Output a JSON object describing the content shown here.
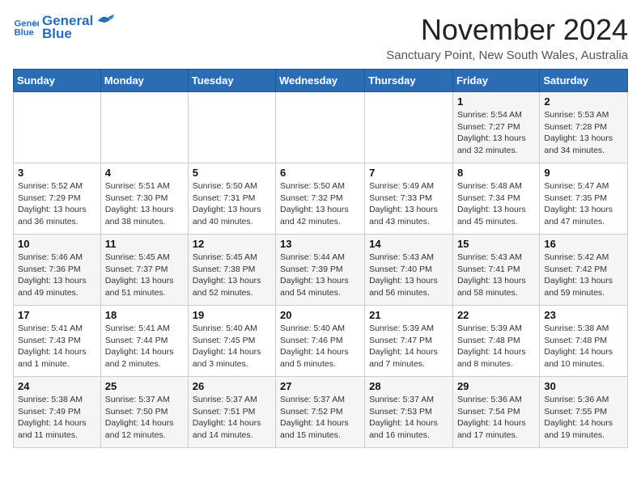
{
  "logo": {
    "line1": "General",
    "line2": "Blue"
  },
  "title": "November 2024",
  "location": "Sanctuary Point, New South Wales, Australia",
  "days_of_week": [
    "Sunday",
    "Monday",
    "Tuesday",
    "Wednesday",
    "Thursday",
    "Friday",
    "Saturday"
  ],
  "weeks": [
    [
      {
        "day": "",
        "info": ""
      },
      {
        "day": "",
        "info": ""
      },
      {
        "day": "",
        "info": ""
      },
      {
        "day": "",
        "info": ""
      },
      {
        "day": "",
        "info": ""
      },
      {
        "day": "1",
        "info": "Sunrise: 5:54 AM\nSunset: 7:27 PM\nDaylight: 13 hours and 32 minutes."
      },
      {
        "day": "2",
        "info": "Sunrise: 5:53 AM\nSunset: 7:28 PM\nDaylight: 13 hours and 34 minutes."
      }
    ],
    [
      {
        "day": "3",
        "info": "Sunrise: 5:52 AM\nSunset: 7:29 PM\nDaylight: 13 hours and 36 minutes."
      },
      {
        "day": "4",
        "info": "Sunrise: 5:51 AM\nSunset: 7:30 PM\nDaylight: 13 hours and 38 minutes."
      },
      {
        "day": "5",
        "info": "Sunrise: 5:50 AM\nSunset: 7:31 PM\nDaylight: 13 hours and 40 minutes."
      },
      {
        "day": "6",
        "info": "Sunrise: 5:50 AM\nSunset: 7:32 PM\nDaylight: 13 hours and 42 minutes."
      },
      {
        "day": "7",
        "info": "Sunrise: 5:49 AM\nSunset: 7:33 PM\nDaylight: 13 hours and 43 minutes."
      },
      {
        "day": "8",
        "info": "Sunrise: 5:48 AM\nSunset: 7:34 PM\nDaylight: 13 hours and 45 minutes."
      },
      {
        "day": "9",
        "info": "Sunrise: 5:47 AM\nSunset: 7:35 PM\nDaylight: 13 hours and 47 minutes."
      }
    ],
    [
      {
        "day": "10",
        "info": "Sunrise: 5:46 AM\nSunset: 7:36 PM\nDaylight: 13 hours and 49 minutes."
      },
      {
        "day": "11",
        "info": "Sunrise: 5:45 AM\nSunset: 7:37 PM\nDaylight: 13 hours and 51 minutes."
      },
      {
        "day": "12",
        "info": "Sunrise: 5:45 AM\nSunset: 7:38 PM\nDaylight: 13 hours and 52 minutes."
      },
      {
        "day": "13",
        "info": "Sunrise: 5:44 AM\nSunset: 7:39 PM\nDaylight: 13 hours and 54 minutes."
      },
      {
        "day": "14",
        "info": "Sunrise: 5:43 AM\nSunset: 7:40 PM\nDaylight: 13 hours and 56 minutes."
      },
      {
        "day": "15",
        "info": "Sunrise: 5:43 AM\nSunset: 7:41 PM\nDaylight: 13 hours and 58 minutes."
      },
      {
        "day": "16",
        "info": "Sunrise: 5:42 AM\nSunset: 7:42 PM\nDaylight: 13 hours and 59 minutes."
      }
    ],
    [
      {
        "day": "17",
        "info": "Sunrise: 5:41 AM\nSunset: 7:43 PM\nDaylight: 14 hours and 1 minute."
      },
      {
        "day": "18",
        "info": "Sunrise: 5:41 AM\nSunset: 7:44 PM\nDaylight: 14 hours and 2 minutes."
      },
      {
        "day": "19",
        "info": "Sunrise: 5:40 AM\nSunset: 7:45 PM\nDaylight: 14 hours and 3 minutes."
      },
      {
        "day": "20",
        "info": "Sunrise: 5:40 AM\nSunset: 7:46 PM\nDaylight: 14 hours and 5 minutes."
      },
      {
        "day": "21",
        "info": "Sunrise: 5:39 AM\nSunset: 7:47 PM\nDaylight: 14 hours and 7 minutes."
      },
      {
        "day": "22",
        "info": "Sunrise: 5:39 AM\nSunset: 7:48 PM\nDaylight: 14 hours and 8 minutes."
      },
      {
        "day": "23",
        "info": "Sunrise: 5:38 AM\nSunset: 7:48 PM\nDaylight: 14 hours and 10 minutes."
      }
    ],
    [
      {
        "day": "24",
        "info": "Sunrise: 5:38 AM\nSunset: 7:49 PM\nDaylight: 14 hours and 11 minutes."
      },
      {
        "day": "25",
        "info": "Sunrise: 5:37 AM\nSunset: 7:50 PM\nDaylight: 14 hours and 12 minutes."
      },
      {
        "day": "26",
        "info": "Sunrise: 5:37 AM\nSunset: 7:51 PM\nDaylight: 14 hours and 14 minutes."
      },
      {
        "day": "27",
        "info": "Sunrise: 5:37 AM\nSunset: 7:52 PM\nDaylight: 14 hours and 15 minutes."
      },
      {
        "day": "28",
        "info": "Sunrise: 5:37 AM\nSunset: 7:53 PM\nDaylight: 14 hours and 16 minutes."
      },
      {
        "day": "29",
        "info": "Sunrise: 5:36 AM\nSunset: 7:54 PM\nDaylight: 14 hours and 17 minutes."
      },
      {
        "day": "30",
        "info": "Sunrise: 5:36 AM\nSunset: 7:55 PM\nDaylight: 14 hours and 19 minutes."
      }
    ]
  ]
}
